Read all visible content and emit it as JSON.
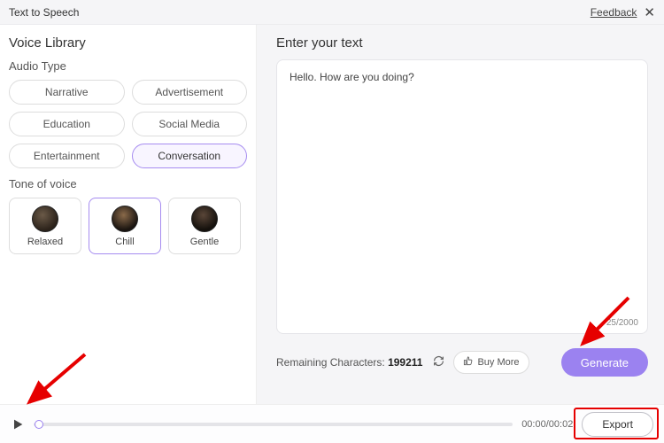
{
  "header": {
    "title": "Text to Speech",
    "feedback": "Feedback"
  },
  "sidebar": {
    "title": "Voice Library",
    "audio_type_label": "Audio Type",
    "audio_types": [
      "Narrative",
      "Advertisement",
      "Education",
      "Social Media",
      "Entertainment",
      "Conversation"
    ],
    "audio_type_selected_index": 5,
    "tone_label": "Tone of voice",
    "tones": [
      "Relaxed",
      "Chill",
      "Gentle"
    ],
    "tone_selected_index": 1
  },
  "main": {
    "enter_label": "Enter your text",
    "text_value": "Hello. How are you doing?",
    "char_used": "25",
    "char_max": "2000",
    "remaining_label": "Remaining Characters:",
    "remaining_value": "199211",
    "buy_more": "Buy More",
    "generate": "Generate"
  },
  "footer": {
    "time_elapsed": "00:00",
    "time_total": "00:02",
    "export": "Export"
  }
}
